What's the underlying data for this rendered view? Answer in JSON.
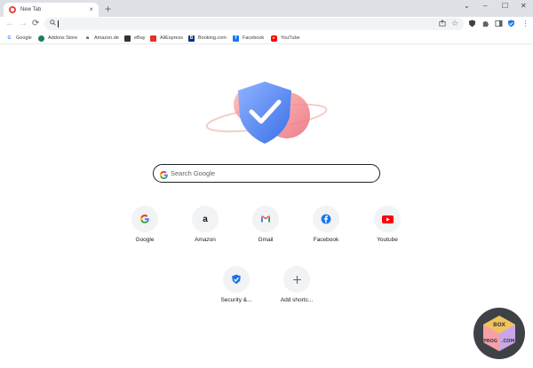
{
  "tab": {
    "title": "New Tab",
    "close": "×"
  },
  "new_tab_button": "+",
  "window_controls": {
    "dropdown": "⌄",
    "minimize": "–",
    "maximize": "☐",
    "close": "✕"
  },
  "toolbar": {
    "back": "←",
    "forward": "→",
    "reload": "⟳",
    "omnibox": {
      "value": ""
    }
  },
  "bookmarks": [
    {
      "label": "Google",
      "icon": "google-icon",
      "color": "#ffffff"
    },
    {
      "label": "Addons Store",
      "icon": "addons-store-icon",
      "color": "#1a7f5a"
    },
    {
      "label": "Amazon.de",
      "icon": "amazon-icon",
      "color": "#ffffff"
    },
    {
      "label": "eBay",
      "icon": "ebay-icon",
      "color": "#ffffff"
    },
    {
      "label": "AliExpress",
      "icon": "aliexpress-icon",
      "color": "#e43225"
    },
    {
      "label": "Booking.com",
      "icon": "booking-icon",
      "color": "#003580"
    },
    {
      "label": "Facebook",
      "icon": "facebook-icon",
      "color": "#1877f2"
    },
    {
      "label": "YouTube",
      "icon": "youtube-icon",
      "color": "#ff0000"
    }
  ],
  "search": {
    "placeholder": "Search Google"
  },
  "shortcuts": [
    {
      "label": "Google",
      "icon": "google-icon"
    },
    {
      "label": "Amazon",
      "icon": "amazon-icon"
    },
    {
      "label": "Gmail",
      "icon": "gmail-icon"
    },
    {
      "label": "Facebook",
      "icon": "facebook-icon"
    },
    {
      "label": "Youtube",
      "icon": "youtube-icon"
    },
    {
      "label": "Security &...",
      "icon": "shield-icon"
    },
    {
      "label": "Add shortc...",
      "icon": "plus-icon"
    }
  ],
  "watermark": {
    "top": "BOX",
    "left": "PROG",
    "right": ".COM"
  },
  "colors": {
    "accent": "#1a73e8",
    "tabstrip": "#dee1e6",
    "omnibox": "#f1f3f4"
  }
}
